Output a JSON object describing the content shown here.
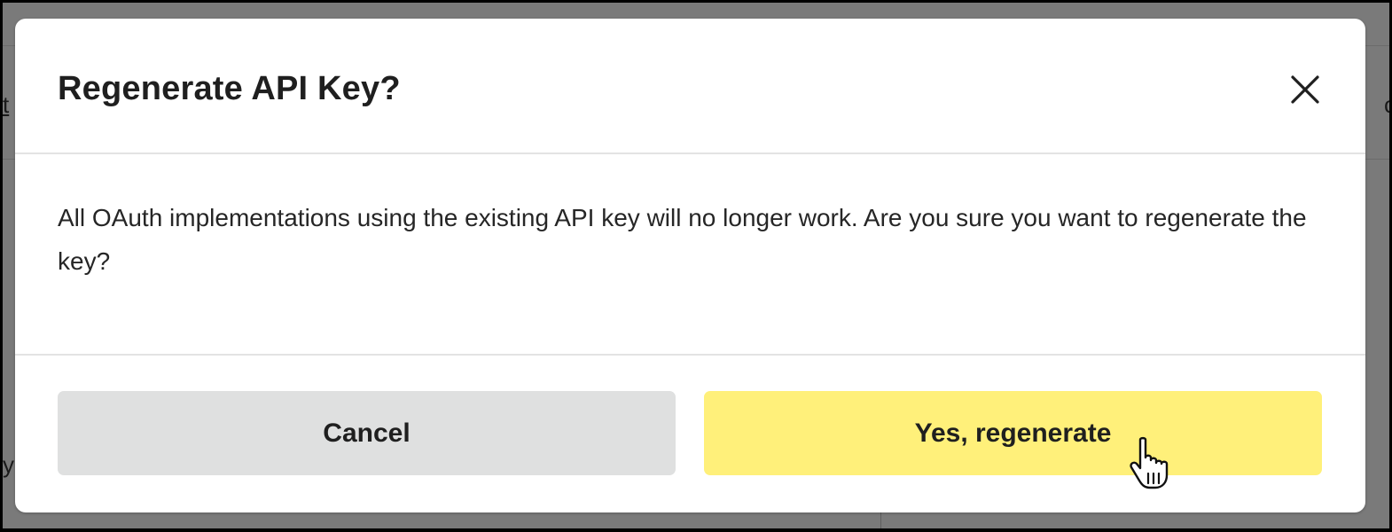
{
  "dialog": {
    "title": "Regenerate API Key?",
    "message": "All OAuth implementations using the existing API key will no longer work. Are you sure you want to regenerate the key?",
    "close_icon": "close-icon",
    "cancel_label": "Cancel",
    "confirm_label": "Yes, regenerate"
  },
  "cursor": {
    "icon": "hand-pointer-icon"
  },
  "colors": {
    "confirm_button": "#fff07a",
    "cancel_button": "#dfe0e0",
    "backdrop": "#7a7a7a",
    "title_text": "#1f1f1f"
  }
}
